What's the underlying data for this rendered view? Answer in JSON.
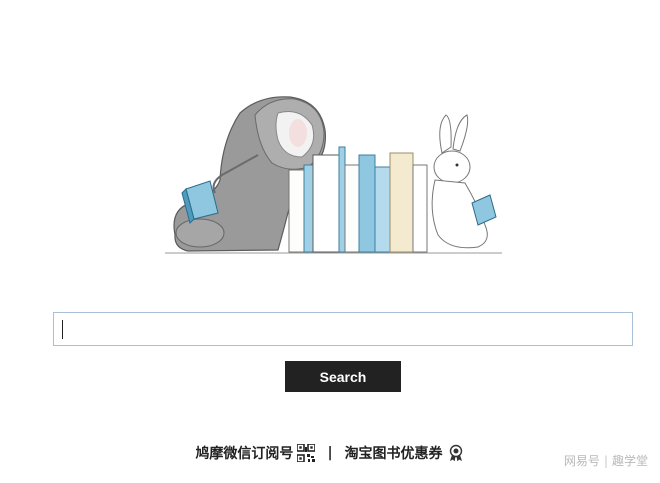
{
  "search": {
    "value": "",
    "button_label": "Search"
  },
  "footer": {
    "wechat_link": "鸠摩微信订阅号",
    "separator": "|",
    "taobao_link": "淘宝图书优惠券"
  },
  "watermark": {
    "left": "网易号",
    "separator": "|",
    "right": "趣学堂"
  },
  "colors": {
    "button_bg": "#222222",
    "input_border": "#a9bfd6",
    "book_blue": "#8fc7e0",
    "book_cream": "#f3ead0",
    "elephant_gray": "#8d8d8d"
  },
  "icons": {
    "qr": "qr-code-icon",
    "badge": "award-badge-icon"
  }
}
